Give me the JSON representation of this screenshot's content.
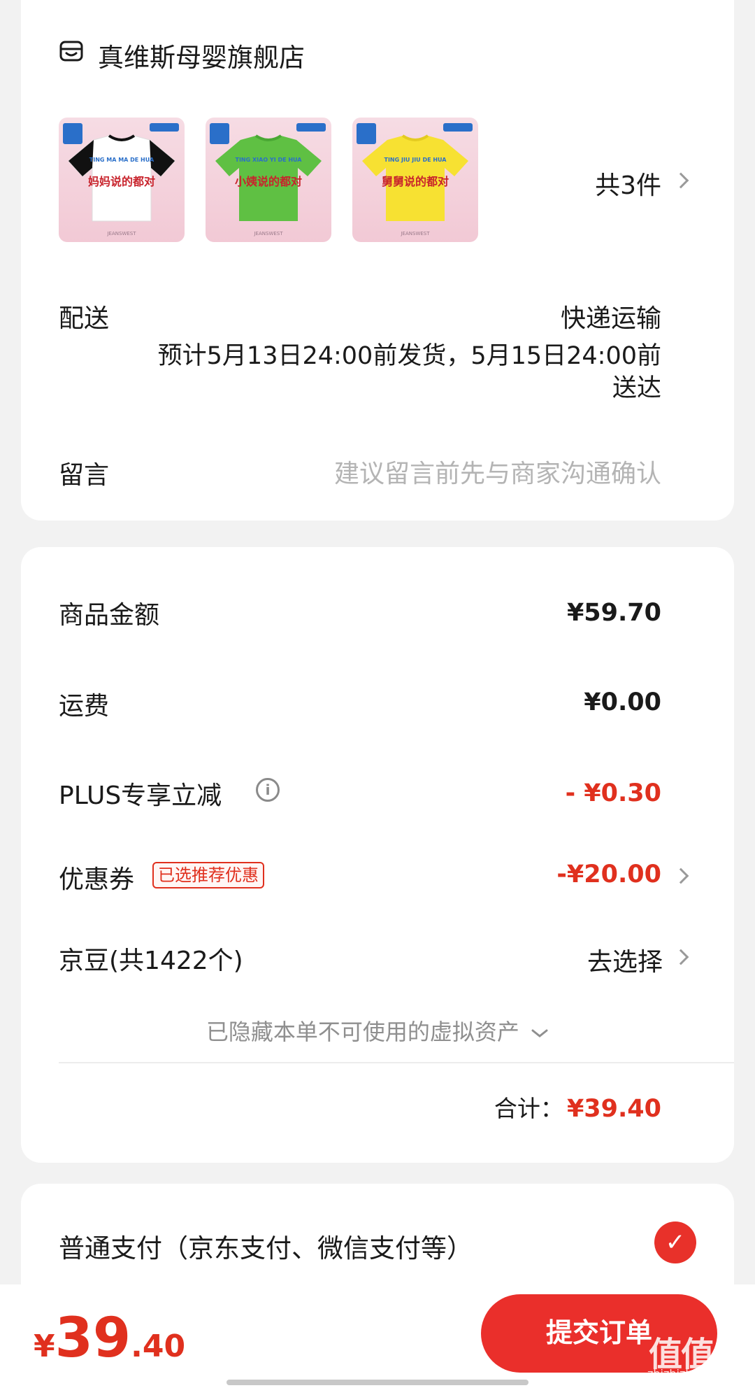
{
  "store": {
    "icon": "store-icon",
    "name": "真维斯母婴旗舰店"
  },
  "products": {
    "items": [
      {
        "text": "妈妈说的都对",
        "sub": "TING MA MA DE HUA"
      },
      {
        "text": "小姨说的都对",
        "sub": "TING XIAO YI DE HUA"
      },
      {
        "text": "舅舅说的都对",
        "sub": "TING JIU JIU DE HUA"
      }
    ],
    "count_label": "共3件"
  },
  "delivery": {
    "label": "配送",
    "method": "快递运输",
    "eta_line1": "预计5月13日24:00前发货，5月15日24:00前",
    "eta_line2": "送达"
  },
  "message": {
    "label": "留言",
    "placeholder": "建议留言前先与商家沟通确认"
  },
  "pricing": {
    "goods_label": "商品金额",
    "goods_value": "¥59.70",
    "shipping_label": "运费",
    "shipping_value": "¥0.00",
    "plus_label": "PLUS专享立减",
    "plus_value": "- ¥0.30",
    "coupon_label": "优惠券",
    "coupon_tag": "已选推荐优惠",
    "coupon_value": "-¥20.00",
    "jingdou_label": "京豆(共1422个)",
    "jingdou_action": "去选择",
    "hidden_assets": "已隐藏本单不可使用的虚拟资产",
    "total_label": "合计：",
    "total_value": "¥39.40"
  },
  "payment": {
    "option_label": "普通支付（京东支付、微信支付等）",
    "selected": true
  },
  "bottom": {
    "currency": "¥",
    "price_int": "39",
    "price_dec": ".40",
    "submit_label": "提交订单"
  },
  "watermark": {
    "brand": "值值值",
    "url": "zhizhizhi.com"
  },
  "colors": {
    "accent": "#e8312a",
    "price_red": "#e0301e",
    "background": "#f2f2f2"
  }
}
